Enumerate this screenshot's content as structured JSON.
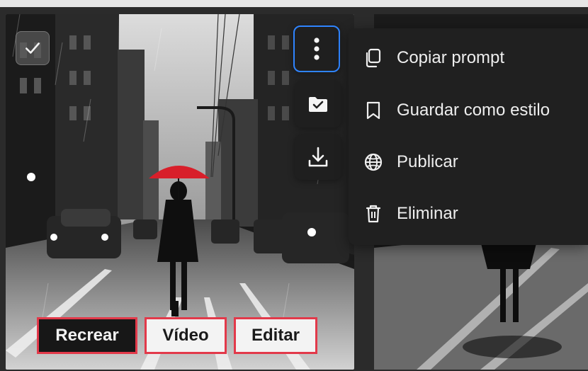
{
  "menu": {
    "items": [
      {
        "label": "Copiar prompt",
        "icon": "copy-icon"
      },
      {
        "label": "Guardar como estilo",
        "icon": "bookmark-icon"
      },
      {
        "label": "Publicar",
        "icon": "globe-icon"
      },
      {
        "label": "Eliminar",
        "icon": "trash-icon"
      }
    ]
  },
  "actions": {
    "recreate": "Recrear",
    "video": "Vídeo",
    "edit": "Editar"
  },
  "colors": {
    "accent_focus": "#2f84ff",
    "highlight_border": "#e2394a",
    "umbrella_red": "#d81f2a"
  }
}
